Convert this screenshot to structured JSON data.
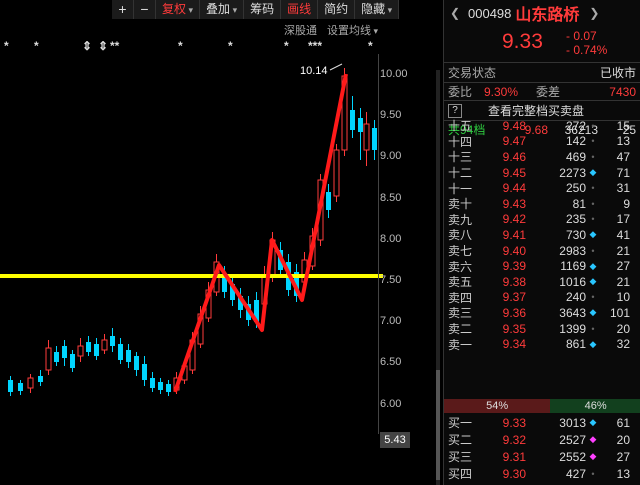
{
  "toolbar": {
    "plus": "+",
    "minus": "−",
    "rights": "复权",
    "overlay": "叠加",
    "chips": "筹码",
    "draw": "画线",
    "simple": "简约",
    "hide": "隐藏"
  },
  "subbar": {
    "sh_sz": "深股通",
    "set_ma": "设置均线"
  },
  "chart": {
    "high_label": "10.14",
    "price_ticks": [
      "10.00",
      "9.50",
      "9.00",
      "8.50",
      "8.00",
      "7.50",
      "7.00",
      "6.50",
      "6.00"
    ],
    "current_tag": "5.43",
    "colors": {
      "up": "#ff3b3b",
      "down": "#00d5ff",
      "support": "#ffff00",
      "draw": "#ff1a1a"
    }
  },
  "header": {
    "code": "000498",
    "name": "山东路桥",
    "price": "9.33",
    "change": "- 0.07",
    "change_pct": "- 0.74%"
  },
  "status": {
    "label": "交易状态",
    "value": "已收市"
  },
  "ratio": {
    "label1": "委比",
    "value1": "9.30%",
    "label2": "委差",
    "value2": "7430"
  },
  "full_book": {
    "q": "?",
    "label": "查看完整档买卖盘"
  },
  "total": {
    "label": "共94档",
    "price": "9.68",
    "volume": "36213",
    "count": "25"
  },
  "asks": [
    {
      "label": "十五",
      "price": "9.48",
      "volume": "272",
      "flag": "dot",
      "count": "15"
    },
    {
      "label": "十四",
      "price": "9.47",
      "volume": "142",
      "flag": "dot",
      "count": "13"
    },
    {
      "label": "十三",
      "price": "9.46",
      "volume": "469",
      "flag": "dot",
      "count": "47"
    },
    {
      "label": "十二",
      "price": "9.45",
      "volume": "2273",
      "flag": "diamond",
      "count": "71"
    },
    {
      "label": "十一",
      "price": "9.44",
      "volume": "250",
      "flag": "dot",
      "count": "31"
    },
    {
      "label": "卖十",
      "price": "9.43",
      "volume": "81",
      "flag": "dot",
      "count": "9"
    },
    {
      "label": "卖九",
      "price": "9.42",
      "volume": "235",
      "flag": "dot",
      "count": "17"
    },
    {
      "label": "卖八",
      "price": "9.41",
      "volume": "730",
      "flag": "diamond",
      "count": "41"
    },
    {
      "label": "卖七",
      "price": "9.40",
      "volume": "2983",
      "flag": "dot",
      "count": "21"
    },
    {
      "label": "卖六",
      "price": "9.39",
      "volume": "1169",
      "flag": "diamond",
      "count": "27"
    },
    {
      "label": "卖五",
      "price": "9.38",
      "volume": "1016",
      "flag": "diamond",
      "count": "21"
    },
    {
      "label": "卖四",
      "price": "9.37",
      "volume": "240",
      "flag": "dot",
      "count": "10"
    },
    {
      "label": "卖三",
      "price": "9.36",
      "volume": "3643",
      "flag": "diamond",
      "count": "101"
    },
    {
      "label": "卖二",
      "price": "9.35",
      "volume": "1399",
      "flag": "dot",
      "count": "20"
    },
    {
      "label": "卖一",
      "price": "9.34",
      "volume": "861",
      "flag": "diamond",
      "count": "32"
    }
  ],
  "balance": {
    "sell_pct": "54%",
    "buy_pct": "46%",
    "sell_share": 54
  },
  "bids": [
    {
      "label": "买一",
      "price": "9.33",
      "volume": "3013",
      "flag": "diamond",
      "count": "61"
    },
    {
      "label": "买二",
      "price": "9.32",
      "volume": "2527",
      "flag": "pink",
      "count": "20"
    },
    {
      "label": "买三",
      "price": "9.31",
      "volume": "2552",
      "flag": "pink",
      "count": "27"
    },
    {
      "label": "买四",
      "price": "9.30",
      "volume": "427",
      "flag": "dot",
      "count": "13"
    }
  ]
}
